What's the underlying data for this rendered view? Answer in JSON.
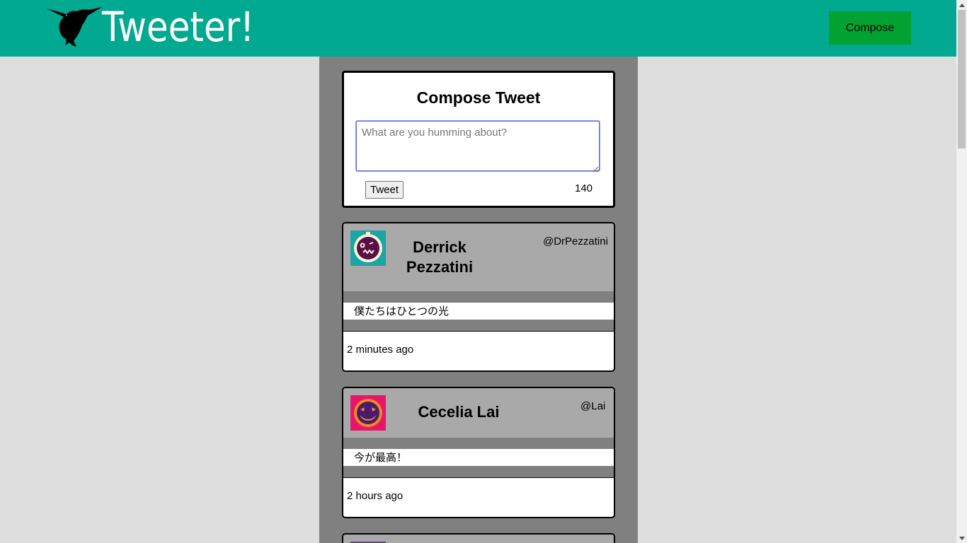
{
  "app": {
    "brand_name": "Tweeter!",
    "logo_icon": "hummingbird-icon",
    "accent_color": "#00a98f",
    "compose_button_color": "#02a232"
  },
  "nav": {
    "compose_label": "Compose"
  },
  "compose": {
    "title": "Compose Tweet",
    "placeholder": "What are you humming about?",
    "value": "",
    "submit_label": "Tweet",
    "char_counter": "140"
  },
  "tweets": [
    {
      "author_name": "Derrick Pezzatini",
      "handle": "@DrPezzatini",
      "content": "僕たちはひとつの光",
      "time_ago": "2 minutes ago",
      "avatar_icon": "monster-face-avatar-icon",
      "avatar_bg": "#1aa6a6",
      "avatar_face": "#5a0f4a",
      "avatar_ring": "#f5f5d0"
    },
    {
      "author_name": "Cecelia Lai",
      "handle": "@Lai",
      "content": "今が最高！",
      "time_ago": "2 hours ago",
      "avatar_icon": "pumpkin-face-avatar-icon",
      "avatar_bg": "#e8156b",
      "avatar_face": "#4a1a6e",
      "avatar_ring": "#f08a1c"
    }
  ]
}
